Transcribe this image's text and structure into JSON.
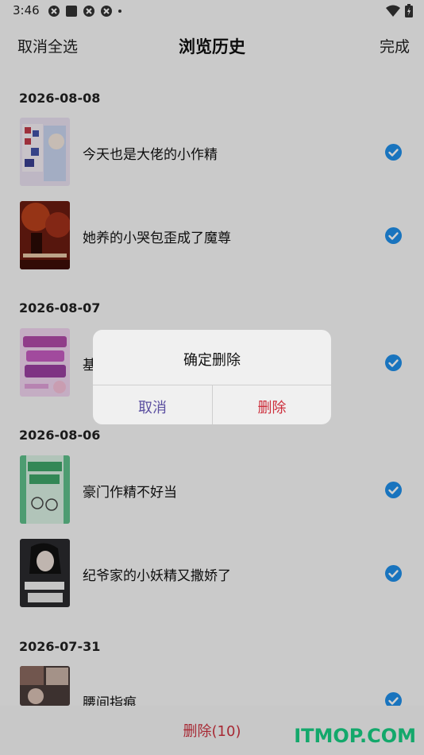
{
  "status_bar": {
    "time": "3:46"
  },
  "nav": {
    "left_label": "取消全选",
    "title": "浏览历史",
    "right_label": "完成"
  },
  "groups": [
    {
      "date": "2026-08-08",
      "items": [
        {
          "title": "今天也是大佬的小作精",
          "checked": true
        },
        {
          "title": "她养的小哭包歪成了魔尊",
          "checked": true
        }
      ]
    },
    {
      "date": "2026-08-07",
      "items": [
        {
          "title": "基",
          "checked": true
        }
      ]
    },
    {
      "date": "2026-08-06",
      "items": [
        {
          "title": "豪门作精不好当",
          "checked": true
        },
        {
          "title": "纪爷家的小妖精又撒娇了",
          "checked": true
        }
      ]
    },
    {
      "date": "2026-07-31",
      "items": [
        {
          "title": "腰间指痕",
          "checked": true
        }
      ]
    }
  ],
  "bottom": {
    "delete_label": "删除(10)",
    "watermark": "ITMOP.COM"
  },
  "dialog": {
    "message": "确定删除",
    "cancel_label": "取消",
    "confirm_label": "删除"
  },
  "colors": {
    "accent_blue": "#1f8ee8",
    "delete_red": "#cc3340",
    "cancel_purple": "#5b4fa0",
    "watermark_green": "#13a86b"
  }
}
